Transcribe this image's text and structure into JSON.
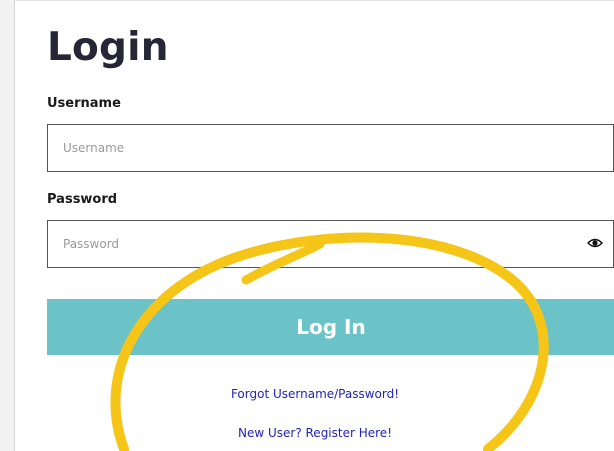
{
  "login_form": {
    "title": "Login",
    "username": {
      "label": "Username",
      "placeholder": "Username",
      "value": ""
    },
    "password": {
      "label": "Password",
      "placeholder": "Password",
      "value": "",
      "toggle_icon": "eye-icon"
    },
    "submit_label": "Log In",
    "forgot_link": "Forgot Username/Password!",
    "register_link": "New User? Register Here!"
  },
  "colors": {
    "button": "#6cc3c7",
    "link": "#2323b8",
    "annotation": "#f5c518"
  }
}
